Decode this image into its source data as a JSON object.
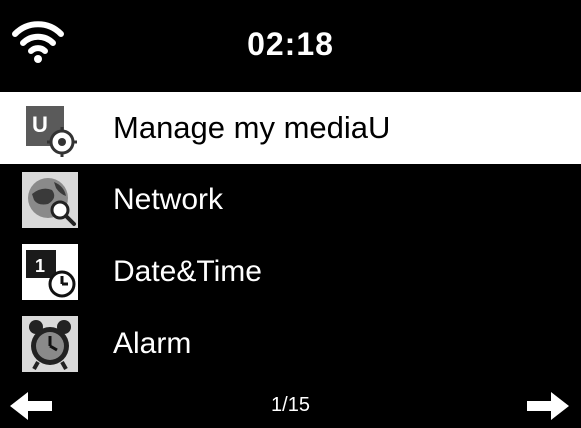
{
  "status": {
    "time": "02:18",
    "wifi_icon": "wifi-icon"
  },
  "menu": {
    "items": [
      {
        "label": "Manage my mediaU",
        "icon": "media-u-icon",
        "selected": true
      },
      {
        "label": "Network",
        "icon": "network-globe-icon",
        "selected": false
      },
      {
        "label": "Date&Time",
        "icon": "calendar-clock-icon",
        "selected": false
      },
      {
        "label": "Alarm",
        "icon": "alarm-clock-icon",
        "selected": false
      }
    ]
  },
  "footer": {
    "page": "1/15",
    "prev_icon": "arrow-left-icon",
    "next_icon": "arrow-right-icon"
  },
  "colors": {
    "background": "#000000",
    "selected_bg": "#ffffff",
    "text": "#ffffff",
    "selected_text": "#000000"
  }
}
